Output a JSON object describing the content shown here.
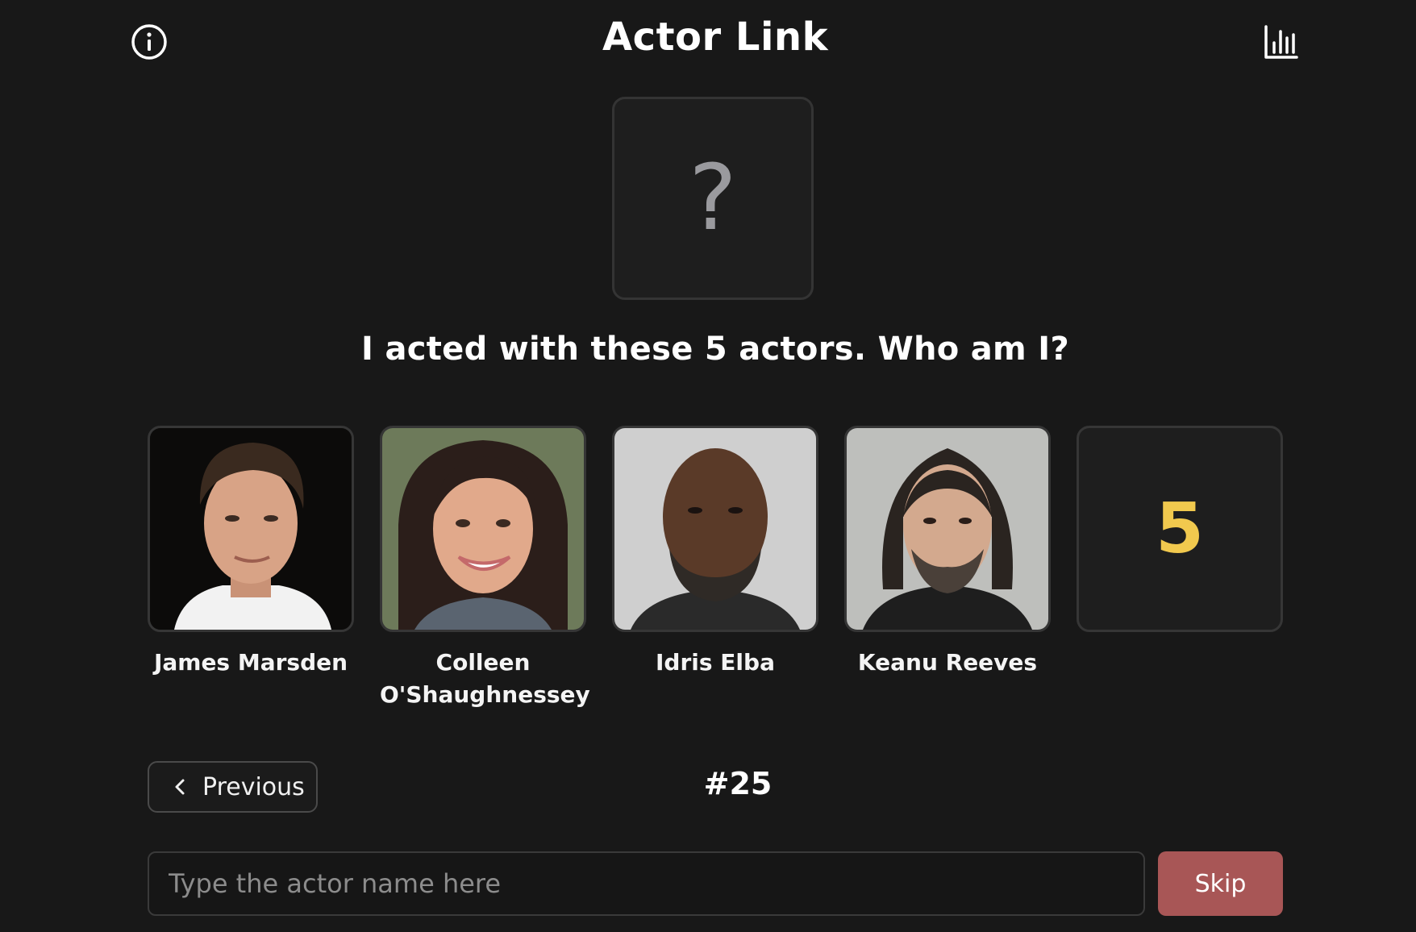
{
  "header": {
    "title": "Actor Link",
    "info_icon": "info-circle-icon",
    "stats_icon": "bar-chart-icon"
  },
  "mystery": {
    "symbol": "?"
  },
  "question": "I acted with these 5 actors. Who am I?",
  "actors": [
    {
      "name": "James Marsden"
    },
    {
      "name": "Colleen O'Shaughnessey"
    },
    {
      "name": "Idris Elba"
    },
    {
      "name": "Keanu Reeves"
    }
  ],
  "remaining_count": "5",
  "nav": {
    "previous_label": "Previous",
    "puzzle_number": "#25"
  },
  "answer": {
    "placeholder": "Type the actor name here",
    "skip_label": "Skip"
  },
  "colors": {
    "accent_count": "#f1c94e",
    "skip_button": "#a85656",
    "background": "#181818"
  }
}
